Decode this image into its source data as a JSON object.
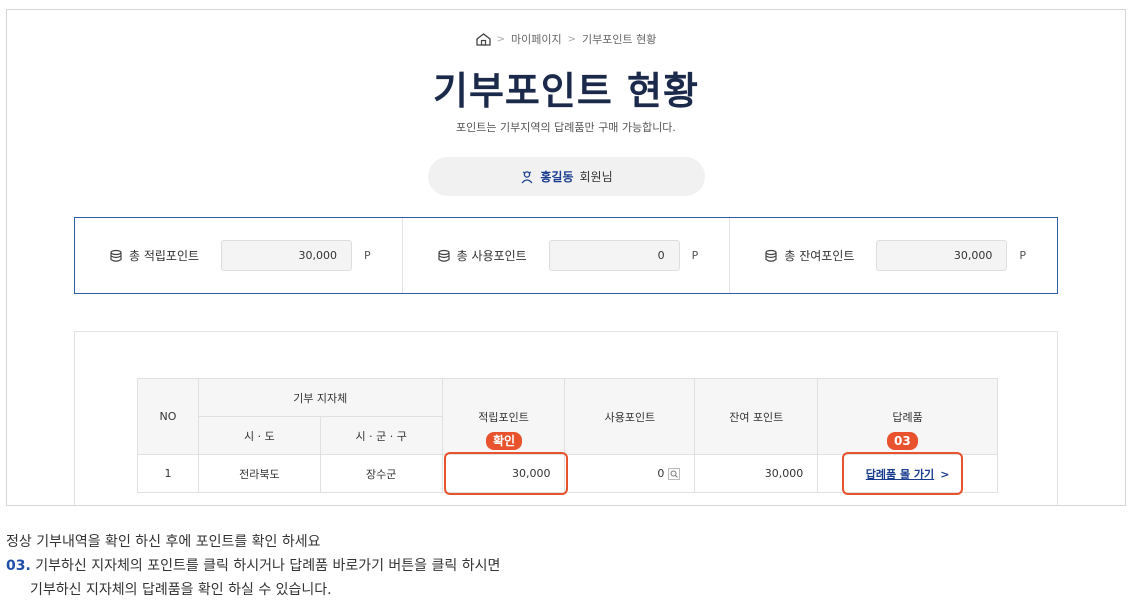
{
  "breadcrumb": {
    "items": [
      "마이페이지",
      "기부포인트 현황"
    ]
  },
  "page": {
    "title": "기부포인트 현황",
    "subtitle": "포인트는 기부지역의 답례품만 구매 가능합니다."
  },
  "user": {
    "name": "홍길동",
    "suffix": "회원님"
  },
  "summary": [
    {
      "label": "총 적립포인트",
      "value": "30,000",
      "unit": "P"
    },
    {
      "label": "총 사용포인트",
      "value": "0",
      "unit": "P"
    },
    {
      "label": "총 잔여포인트",
      "value": "30,000",
      "unit": "P"
    }
  ],
  "table": {
    "headers": {
      "no": "NO",
      "region": "기부 지자체",
      "sido": "시 · 도",
      "sigungu": "시 · 군 · 구",
      "earned": "적립포인트",
      "used": "사용포인트",
      "remaining": "잔여 포인트",
      "gift": "답례품"
    },
    "rows": [
      {
        "no": "1",
        "sido": "전라북도",
        "sigungu": "장수군",
        "earned": "30,000",
        "used": "0",
        "remaining": "30,000",
        "gift_link": "답례품 몰 가기"
      }
    ]
  },
  "annotations": {
    "confirm_badge": "확인",
    "step_badge": "03"
  },
  "footnote": {
    "line1": "정상 기부내역을 확인 하신 후에 포인트를 확인 하세요",
    "step_num": "03.",
    "line2": " 기부하신 지자체의 포인트를 클릭 하시거나 답례품 바로가기 버튼을 클릭 하시면",
    "line3": "기부하신 지자체의 답례품을 확인 하실 수 있습니다."
  },
  "colors": {
    "accent": "#1a3d8f",
    "highlight": "#e8532e",
    "summary_border": "#2f5ea8"
  }
}
